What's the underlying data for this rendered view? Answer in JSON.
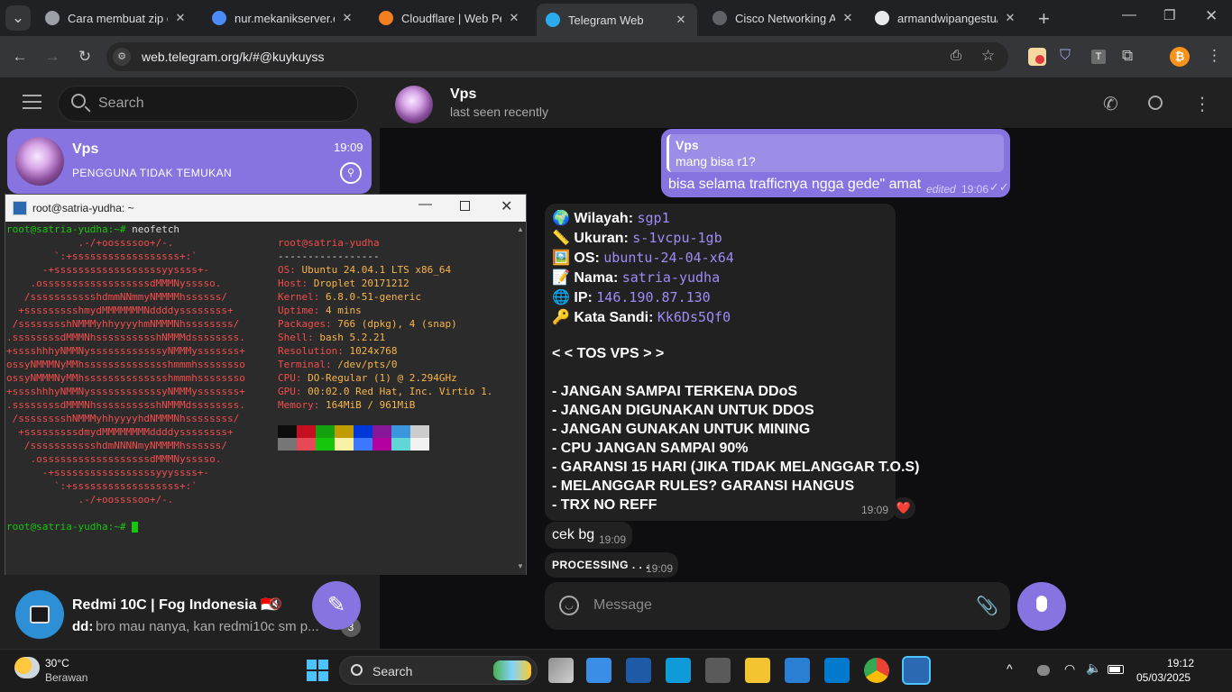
{
  "browser": {
    "tabs": [
      {
        "title": "Cara membuat zip di",
        "color": "#9aa0a6"
      },
      {
        "title": "nur.mekanikserver.com",
        "color": "#4c8bf5"
      },
      {
        "title": "Cloudflare | Web Perf",
        "color": "#f38020"
      },
      {
        "title": "Telegram Web",
        "color": "#2aabee"
      },
      {
        "title": "Cisco Networking Ac",
        "color": "#5f6368"
      },
      {
        "title": "armandwipangestu/e",
        "color": "#e8eaed"
      }
    ],
    "url": "web.telegram.org/k/#@kuykuyss"
  },
  "sidebar": {
    "search_placeholder": "Search",
    "pinned_chat": {
      "name": "Vps",
      "time": "19:09",
      "preview": "PENGGUNA TIDAK TEMUKAN"
    },
    "bottom_chat": {
      "name": "Redmi 10C | Fog Indonesia 🇮🇩",
      "sender": "dd:",
      "preview": "bro mau nanya, kan redmi10c sm p...",
      "unread": "3"
    }
  },
  "terminal": {
    "title": "root@satria-yudha: ~",
    "prompt": "root@satria-yudha:~#",
    "command": "neofetch",
    "logo": [
      "            .-/+oossssoo+/-.",
      "        `:+ssssssssssssssssss+:`",
      "      -+ssssssssssssssssssyyssss+-",
      "    .ossssssssssssssssssdMMMNysssso.",
      "   /ssssssssssshdmmNNmmyNMMMMhssssss/",
      "  +ssssssssshmydMMMMMMMNddddyssssssss+",
      " /sssssssshNMMMyhhyyyyhmNMMMNhssssssss/",
      ".ssssssssdMMMNhsssssssssshNMMMdssssssss.",
      "+sssshhhyNMMNyssssssssssssyNMMMysssssss+",
      "ossyNMMMNyMMhsssssssssssssshmmmhssssssso",
      "ossyNMMMNyMMhsssssssssssssshmmmhssssssso",
      "+sssshhhyNMMNyssssssssssssyNMMMysssssss+",
      ".ssssssssdMMMNhsssssssssshNMMMdssssssss.",
      " /sssssssshNMMMyhhyyyyhdNMMMNhssssssss/",
      "  +sssssssssdmydMMMMMMMMddddyssssssss+",
      "   /ssssssssssshdmNNNNmyNMMMMhssssss/",
      "    .ossssssssssssssssssdMMMNysssso.",
      "      -+sssssssssssssssssyyyssss+-",
      "        `:+ssssssssssssssssss+:`",
      "            .-/+oossssoo+/-."
    ],
    "host_line": "root@satria-yudha",
    "separator": "-----------------",
    "info": [
      {
        "key": "OS:",
        "val": "Ubuntu 24.04.1 LTS x86_64"
      },
      {
        "key": "Host:",
        "val": "Droplet 20171212"
      },
      {
        "key": "Kernel:",
        "val": "6.8.0-51-generic"
      },
      {
        "key": "Uptime:",
        "val": "4 mins"
      },
      {
        "key": "Packages:",
        "val": "766 (dpkg), 4 (snap)"
      },
      {
        "key": "Shell:",
        "val": "bash 5.2.21"
      },
      {
        "key": "Resolution:",
        "val": "1024x768"
      },
      {
        "key": "Terminal:",
        "val": "/dev/pts/0"
      },
      {
        "key": "CPU:",
        "val": "DO-Regular (1) @ 2.294GHz"
      },
      {
        "key": "GPU:",
        "val": "00:02.0 Red Hat, Inc. Virtio 1."
      },
      {
        "key": "Memory:",
        "val": "164MiB / 961MiB"
      }
    ],
    "palette_top": [
      "#0c0c0c",
      "#c50f1f",
      "#13a10e",
      "#c19c00",
      "#0037da",
      "#881798",
      "#3a96dd",
      "#cccccc"
    ],
    "palette_bottom": [
      "#767676",
      "#e74856",
      "#16c60c",
      "#f9f1a5",
      "#3b78ff",
      "#b4009e",
      "#61d6d6",
      "#f2f2f2"
    ]
  },
  "chat": {
    "name": "Vps",
    "status": "last seen recently",
    "out_message": {
      "reply_name": "Vps",
      "reply_text": "mang bisa r1?",
      "text": "bisa selama trafficnya ngga gede\" amat",
      "edited": "edited",
      "time": "19:06"
    },
    "info_lines": [
      {
        "icon": "🌍",
        "label": "Wilayah:",
        "value": "sgp1"
      },
      {
        "icon": "📏",
        "label": "Ukuran:",
        "value": "s-1vcpu-1gb"
      },
      {
        "icon": "🖼️",
        "label": "OS:",
        "value": "ubuntu-24-04-x64"
      },
      {
        "icon": "📝",
        "label": "Nama:",
        "value": "satria-yudha"
      },
      {
        "icon": "🌐",
        "label": "IP:",
        "value": "146.190.87.130"
      },
      {
        "icon": "🔑",
        "label": "Kata Sandi:",
        "value": "Kk6Ds5Qf0"
      }
    ],
    "tos_title": "< <  TOS VPS  > >",
    "tos_rules": [
      "- JANGAN SAMPAI TERKENA DDoS",
      "- JANGAN DIGUNAKAN UNTUK DDOS",
      "- JANGAN GUNAKAN UNTUK MINING",
      "- CPU JANGAN SAMPAI 90%",
      "- GARANSI 15 HARI (JIKA TIDAK MELANGGAR T.O.S)",
      "- MELANGGAR RULES? GARANSI HANGUS",
      "- TRX NO REFF"
    ],
    "info_time": "19:09",
    "reaction": "❤️",
    "msg2": {
      "text": "cek bg",
      "time": "19:09"
    },
    "msg3": {
      "text": "PROCESSING . . .",
      "time": "19:09"
    },
    "composer_placeholder": "Message"
  },
  "taskbar": {
    "weather_temp": "30°C",
    "weather_desc": "Berawan",
    "search_label": "Search",
    "time": "19:12",
    "date": "05/03/2025"
  }
}
